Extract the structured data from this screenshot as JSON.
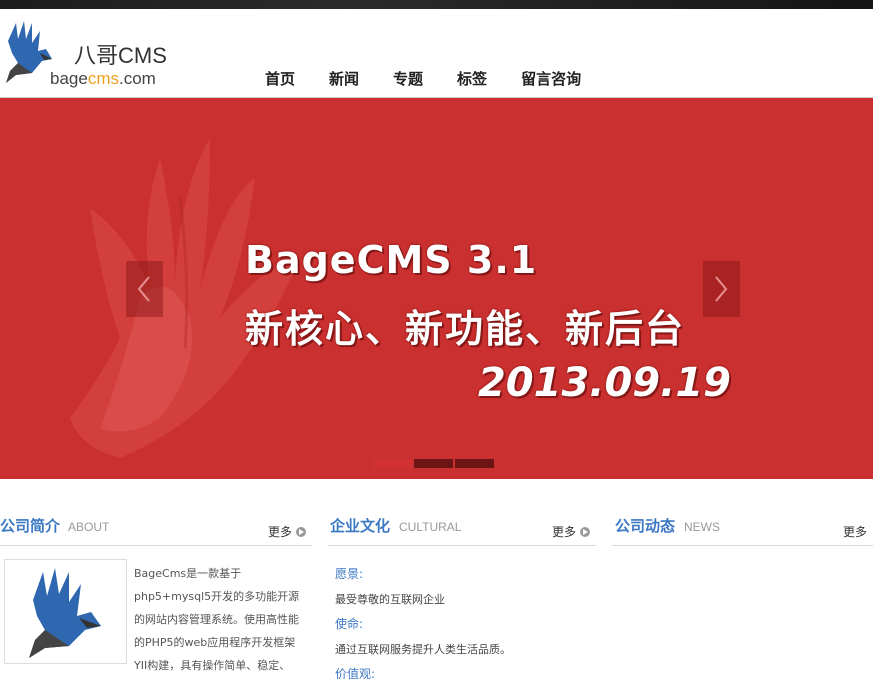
{
  "logo": {
    "cn": "八哥CMS",
    "en_prefix": "bage",
    "en_highlight": "cms",
    "en_suffix": ".com"
  },
  "nav": [
    "首页",
    "新闻",
    "专题",
    "标签",
    "留言咨询"
  ],
  "banner": {
    "line1": "BageCMS 3.1",
    "line2": "新核心、新功能、新后台",
    "line3": "2013.09.19",
    "background": "#c9302f"
  },
  "sections": {
    "about": {
      "title": "公司简介",
      "sub": "ABOUT",
      "more": "更多"
    },
    "culture": {
      "title": "企业文化",
      "sub": "CULTURAL",
      "more": "更多"
    },
    "news": {
      "title": "公司动态",
      "sub": "NEWS",
      "more": "更多"
    }
  },
  "about_text": [
    "BageCms是一款基于",
    "php5+mysql5开发的多功能开源",
    "的网站内容管理系统。使用高性能",
    "的PHP5的web应用程序开发框架",
    "YII构建，具有操作简单、稳定、"
  ],
  "culture_items": [
    {
      "k": "愿景:",
      "v": "最受尊敬的互联网企业"
    },
    {
      "k": "使命:",
      "v": "通过互联网服务提升人类生活品质。"
    },
    {
      "k": "价值观:",
      "v": ""
    }
  ],
  "colors": {
    "accent": "#3b78c4",
    "banner": "#c9302f"
  }
}
